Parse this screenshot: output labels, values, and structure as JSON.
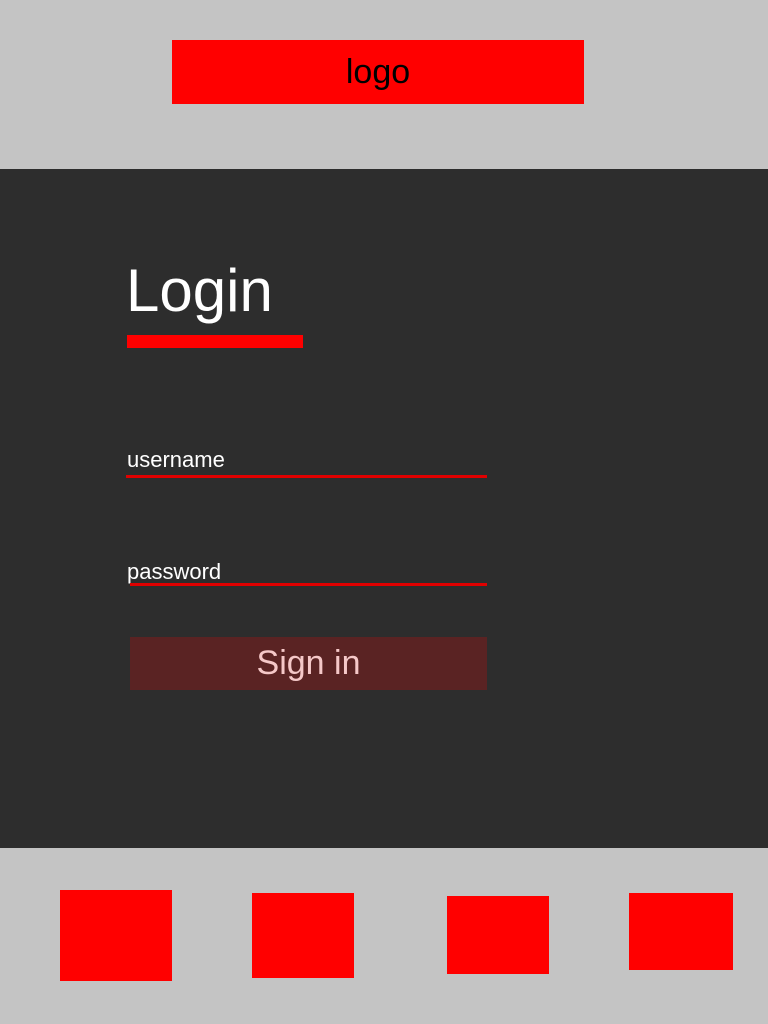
{
  "header": {
    "logo_text": "logo"
  },
  "login": {
    "title": "Login",
    "username_label": "username",
    "password_label": "password",
    "signin_label": "Sign in"
  },
  "colors": {
    "accent": "#ff0000",
    "main_bg": "#2d2d2d",
    "frame_bg": "#c4c4c4",
    "button_bg": "#5a2323",
    "button_text": "#f5c8c8"
  }
}
